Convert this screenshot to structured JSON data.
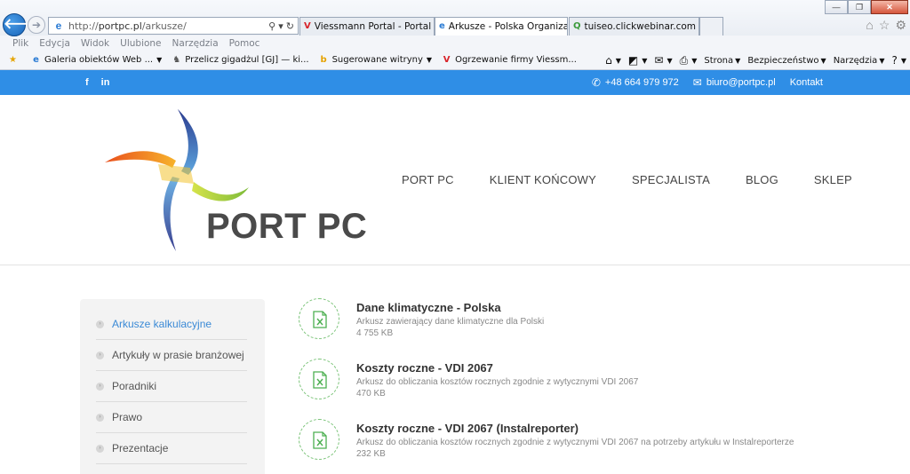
{
  "browser": {
    "url_prefix": "http://",
    "url_host": "portpc.pl",
    "url_path": "/arkusze/",
    "addr_tools": "⚲ ▾ ↻",
    "tabs": [
      {
        "label": "Viessmann Portal - Portal Home",
        "favicon": "V",
        "color": "#d8232a"
      },
      {
        "label": "Arkusze - Polska Organizacj...",
        "favicon": "e",
        "color": "#2a7bd4"
      },
      {
        "label": "tuiseo.clickwebinar.com",
        "favicon": "Q",
        "color": "#3a9a3a"
      }
    ],
    "tab_close": "×",
    "window_buttons": [
      "—",
      "❐",
      "✕"
    ],
    "tool_icons": [
      "⌂",
      "☆",
      "⚙"
    ],
    "menu": [
      "Plik",
      "Edycja",
      "Widok",
      "Ulubione",
      "Narzędzia",
      "Pomoc"
    ],
    "favorites": [
      {
        "label": "",
        "icon": "★",
        "color": "#e5a400",
        "dropdown": false
      },
      {
        "label": "Galeria obiektów Web ...",
        "icon": "e",
        "color": "#2a7bd4",
        "dropdown": true
      },
      {
        "label": "Przelicz gigadżul [GJ] — ki...",
        "icon": "♞",
        "color": "#555555",
        "dropdown": false
      },
      {
        "label": "Sugerowane witryny",
        "icon": "b",
        "color": "#e6a200",
        "dropdown": true
      },
      {
        "label": "Ogrzewanie firmy Viessm...",
        "icon": "V",
        "color": "#d8232a",
        "dropdown": false
      }
    ],
    "command_bar": [
      {
        "label": "",
        "icon": "⌂",
        "dropdown": true
      },
      {
        "label": "",
        "icon": "◩",
        "dropdown": true
      },
      {
        "label": "",
        "icon": "✉",
        "dropdown": true
      },
      {
        "label": "",
        "icon": "⎙",
        "dropdown": true
      },
      {
        "label": "Strona",
        "icon": "",
        "dropdown": true
      },
      {
        "label": "Bezpieczeństwo",
        "icon": "",
        "dropdown": true
      },
      {
        "label": "Narzędzia",
        "icon": "",
        "dropdown": true
      },
      {
        "label": "",
        "icon": "?",
        "dropdown": true
      }
    ]
  },
  "site": {
    "social": [
      "f",
      "in"
    ],
    "phone": "+48 664 979 972",
    "email": "biuro@portpc.pl",
    "contact_link": "Kontakt",
    "phone_glyph": "✆",
    "email_glyph": "✉",
    "logo_text": "PORT PC",
    "nav": [
      "PORT PC",
      "KLIENT KOŃCOWY",
      "SPECJALISTA",
      "BLOG",
      "SKLEP"
    ],
    "sidebar": [
      {
        "label": "Arkusze kalkulacyjne",
        "active": true
      },
      {
        "label": "Artykuły w prasie branżowej",
        "active": false
      },
      {
        "label": "Poradniki",
        "active": false
      },
      {
        "label": "Prawo",
        "active": false
      },
      {
        "label": "Prezentacje",
        "active": false
      }
    ],
    "bullet_glyph": "›",
    "files": [
      {
        "title": "Dane klimatyczne - Polska",
        "desc": "Arkusz zawierający dane klimatyczne dla Polski",
        "size": "4 755 KB"
      },
      {
        "title": "Koszty roczne - VDI 2067",
        "desc": "Arkusz do obliczania kosztów rocznych zgodnie z wytycznymi VDI 2067",
        "size": "470 KB"
      },
      {
        "title": "Koszty roczne - VDI 2067 (Instalreporter)",
        "desc": "Arkusz do obliczania kosztów rocznych zgodnie z wytycznymi VDI 2067 na potrzeby artykułu w Instalreporterze",
        "size": "232 KB"
      }
    ]
  },
  "colors": {
    "accent": "#2f8ee6",
    "link": "#3b8ad6",
    "excel_green": "#4caf50"
  }
}
